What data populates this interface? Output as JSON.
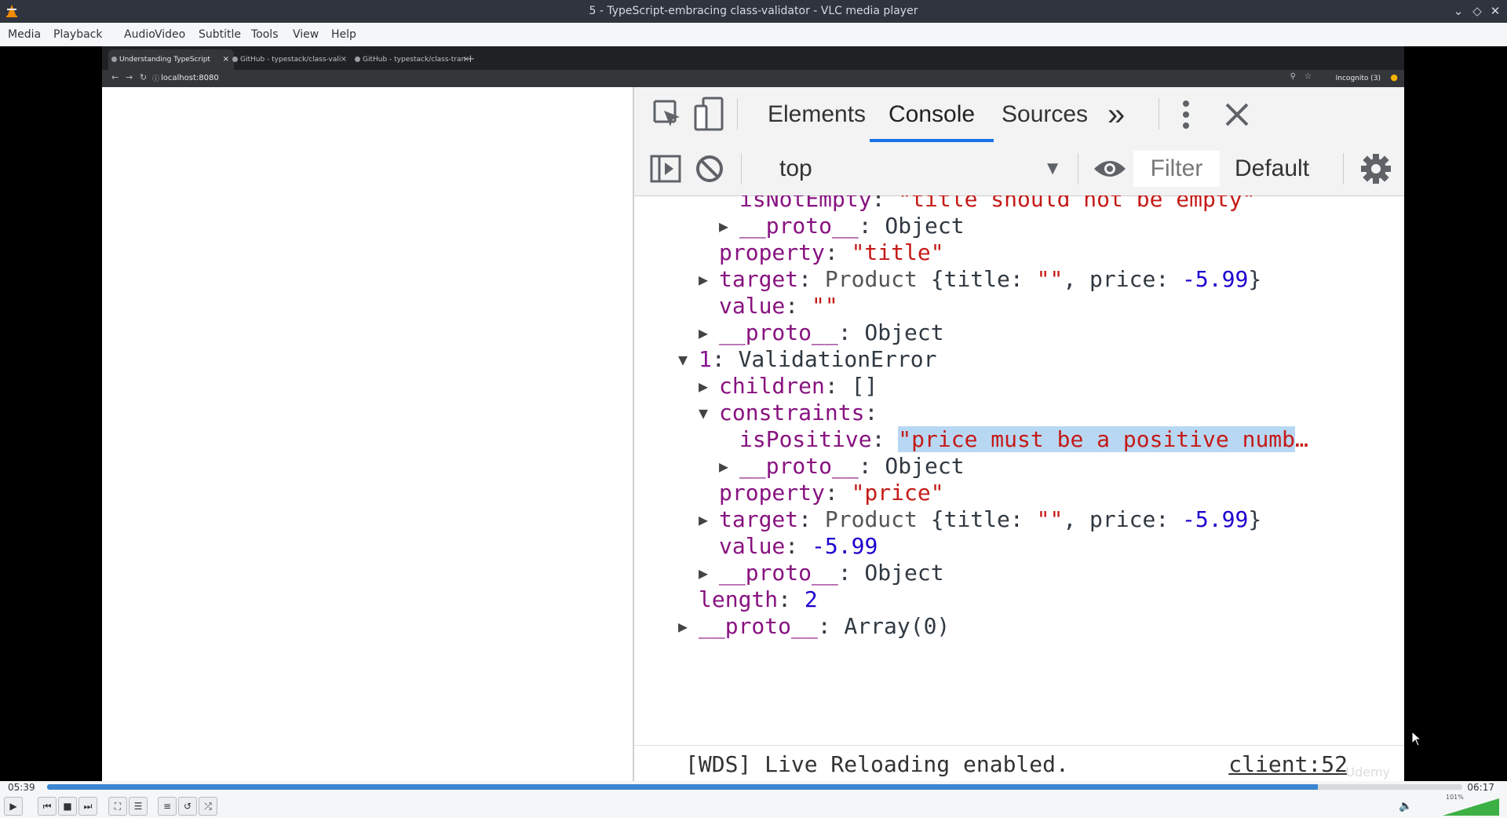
{
  "window": {
    "title": "5 - TypeScript-embracing class-validator - VLC media player"
  },
  "menu": [
    "Media",
    "Playback",
    "Audio",
    "Video",
    "Subtitle",
    "Tools",
    "View",
    "Help"
  ],
  "browser": {
    "tabs": [
      {
        "label": "Understanding TypeScript"
      },
      {
        "label": "GitHub - typestack/class-vali"
      },
      {
        "label": "GitHub - typestack/class-tran"
      }
    ],
    "new_tab": "+",
    "url": "localhost:8080",
    "incognito": "Incognito (3)"
  },
  "devtools": {
    "tabs": [
      "Elements",
      "Console",
      "Sources"
    ],
    "active_tab": "Console",
    "more": "»",
    "context": "top",
    "filter_placeholder": "Filter",
    "levels": "Default",
    "lines": [
      {
        "indent": 2,
        "arrow": "",
        "parts": [
          [
            "k",
            "isNotEmpty"
          ],
          [
            "dim",
            ": "
          ],
          [
            "str",
            "\"title should not be empty\""
          ]
        ]
      },
      {
        "indent": 2,
        "arrow": "right",
        "parts": [
          [
            "k",
            "__proto__"
          ],
          [
            "dim",
            ": Object"
          ]
        ]
      },
      {
        "indent": 1,
        "arrow": "",
        "parts": [
          [
            "k",
            "property"
          ],
          [
            "dim",
            ": "
          ],
          [
            "str",
            "\"title\""
          ]
        ]
      },
      {
        "indent": 1,
        "arrow": "right",
        "parts": [
          [
            "k",
            "target"
          ],
          [
            "dim",
            ": "
          ],
          [
            "gray",
            "Product "
          ],
          [
            "dim",
            "{title: "
          ],
          [
            "str",
            "\"\""
          ],
          [
            "dim",
            ", price: "
          ],
          [
            "num",
            "-5.99"
          ],
          [
            "dim",
            "}"
          ]
        ]
      },
      {
        "indent": 1,
        "arrow": "",
        "parts": [
          [
            "k",
            "value"
          ],
          [
            "dim",
            ": "
          ],
          [
            "str",
            "\"\""
          ]
        ]
      },
      {
        "indent": 1,
        "arrow": "right",
        "parts": [
          [
            "k",
            "__proto__"
          ],
          [
            "dim",
            ": Object"
          ]
        ]
      },
      {
        "indent": 0,
        "arrow": "down",
        "parts": [
          [
            "k2",
            "1"
          ],
          [
            "dim",
            ": ValidationError"
          ]
        ]
      },
      {
        "indent": 1,
        "arrow": "right",
        "parts": [
          [
            "k",
            "children"
          ],
          [
            "dim",
            ": []"
          ]
        ]
      },
      {
        "indent": 1,
        "arrow": "down",
        "parts": [
          [
            "k",
            "constraints"
          ],
          [
            "dim",
            ":"
          ]
        ]
      },
      {
        "indent": 2,
        "arrow": "",
        "parts": [
          [
            "k",
            "isPositive"
          ],
          [
            "dim",
            ": "
          ],
          [
            "sel",
            "\"price must be a positive numb"
          ],
          [
            "str",
            "…"
          ]
        ]
      },
      {
        "indent": 2,
        "arrow": "right",
        "parts": [
          [
            "k",
            "__proto__"
          ],
          [
            "dim",
            ": Object"
          ]
        ]
      },
      {
        "indent": 1,
        "arrow": "",
        "parts": [
          [
            "k",
            "property"
          ],
          [
            "dim",
            ": "
          ],
          [
            "str",
            "\"price\""
          ]
        ]
      },
      {
        "indent": 1,
        "arrow": "right",
        "parts": [
          [
            "k",
            "target"
          ],
          [
            "dim",
            ": "
          ],
          [
            "gray",
            "Product "
          ],
          [
            "dim",
            "{title: "
          ],
          [
            "str",
            "\"\""
          ],
          [
            "dim",
            ", price: "
          ],
          [
            "num",
            "-5.99"
          ],
          [
            "dim",
            "}"
          ]
        ]
      },
      {
        "indent": 1,
        "arrow": "",
        "parts": [
          [
            "k",
            "value"
          ],
          [
            "dim",
            ": "
          ],
          [
            "num",
            "-5.99"
          ]
        ]
      },
      {
        "indent": 1,
        "arrow": "right",
        "parts": [
          [
            "k",
            "__proto__"
          ],
          [
            "dim",
            ": Object"
          ]
        ]
      },
      {
        "indent": 0,
        "arrow": "",
        "parts": [
          [
            "k",
            "length"
          ],
          [
            "dim",
            ": "
          ],
          [
            "num",
            "2"
          ]
        ]
      },
      {
        "indent": 0,
        "arrow": "right",
        "parts": [
          [
            "k",
            "__proto__"
          ],
          [
            "dim",
            ": Array(0)"
          ]
        ]
      }
    ],
    "footer_msg": "[WDS] Live Reloading enabled.",
    "footer_link": "client:52",
    "watermark": "Udemy"
  },
  "player": {
    "elapsed": "05:39",
    "total": "06:17",
    "progress": 0.898,
    "volume_pct": "101%",
    "volume_level": 1.01
  },
  "colors": {
    "accent": "#3a86d1",
    "devtools_active": "#1a73e8"
  }
}
